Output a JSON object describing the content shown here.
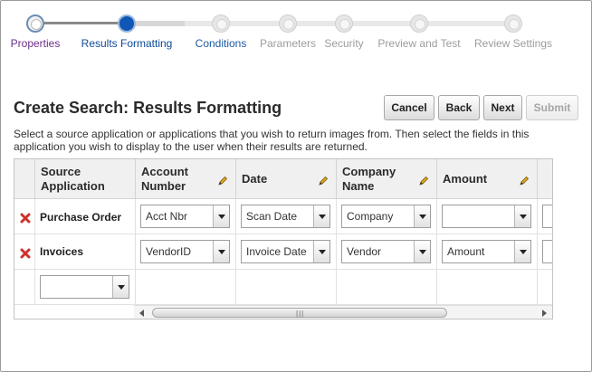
{
  "train": {
    "steps": [
      {
        "label": "Properties",
        "state": "visited"
      },
      {
        "label": "Results Formatting",
        "state": "current"
      },
      {
        "label": "Conditions",
        "state": "next"
      },
      {
        "label": "Parameters",
        "state": "disabled"
      },
      {
        "label": "Security",
        "state": "disabled"
      },
      {
        "label": "Preview and Test",
        "state": "disabled"
      },
      {
        "label": "Review Settings",
        "state": "disabled"
      }
    ]
  },
  "page": {
    "title": "Create Search: Results Formatting",
    "instructions": "Select a source application or applications that you wish to return images from. Then select the fields in this application you wish to display to the user when their results are returned."
  },
  "buttons": {
    "cancel": "Cancel",
    "back": "Back",
    "next": "Next",
    "submit": "Submit"
  },
  "table": {
    "headers": {
      "source_application": "Source Application",
      "account_number": "Account Number",
      "date": "Date",
      "company_name": "Company Name",
      "amount": "Amount"
    },
    "rows": [
      {
        "application": "Purchase Order",
        "account_number": "Acct Nbr",
        "date": "Scan Date",
        "company_name": "Company",
        "amount": ""
      },
      {
        "application": "Invoices",
        "account_number": "VendorID",
        "date": "Invoice Date",
        "company_name": "Vendor",
        "amount": "Amount"
      }
    ],
    "new_row_select": ""
  },
  "icons": {
    "delete": "delete-x-icon",
    "edit": "pencil-icon"
  },
  "colors": {
    "current_step": "#0f56b5",
    "visited_step_label": "#6b2f8a",
    "delete_icon": "#d0302a",
    "pencil": "#d9a21e"
  }
}
